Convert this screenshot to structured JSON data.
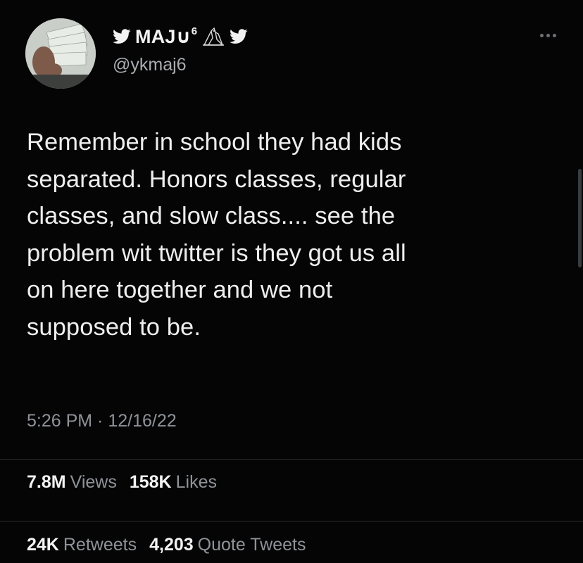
{
  "user": {
    "display_name": "MAJ∪",
    "display_name_sup": "6",
    "handle": "@ykmaj6"
  },
  "tweet": {
    "text": "Remember in school they had kids\nseparated. Honors classes, regular\nclasses, and slow class.... see the\nproblem wit twitter is they got us all\non here together and we not\nsupposed to be.",
    "timestamp": "5:26 PM · 12/16/22"
  },
  "stats": {
    "views": {
      "value": "7.8M",
      "label": "Views"
    },
    "likes": {
      "value": "158K",
      "label": "Likes"
    },
    "retweets": {
      "value": "24K",
      "label": "Retweets"
    },
    "quotes": {
      "value": "4,203",
      "label": "Quote Tweets"
    }
  },
  "icons": [
    "twitter-bird-icon",
    "owl-icon",
    "more-options-icon"
  ],
  "colors": {
    "background": "#050505",
    "text_primary": "#eeeeee",
    "text_secondary": "#8f9398",
    "divider": "#2a2d30"
  }
}
